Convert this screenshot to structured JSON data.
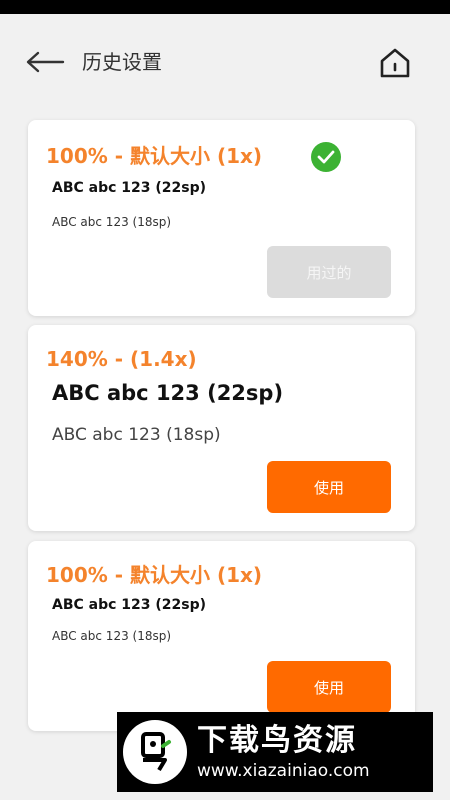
{
  "header": {
    "title": "历史设置",
    "back_icon": "arrow-left-icon",
    "home_icon": "home-icon"
  },
  "options": [
    {
      "title": "100% - 默认大小 (1x)",
      "sample_22": "ABC abc 123 (22sp)",
      "sample_18": "ABC abc 123 (18sp)",
      "button_label": "用过的",
      "selected": true,
      "status_icon": "check-circle-icon"
    },
    {
      "title": "140% - (1.4x)",
      "sample_22": "ABC abc 123 (22sp)",
      "sample_18": "ABC abc 123 (18sp)",
      "button_label": "使用",
      "selected": false
    },
    {
      "title": "100% - 默认大小 (1x)",
      "sample_22": "ABC abc 123 (22sp)",
      "sample_18": "ABC abc 123 (18sp)",
      "button_label": "使用",
      "selected": false
    }
  ],
  "watermark": {
    "title": "下载鸟资源",
    "url": "www.xiazainiao.com"
  },
  "colors": {
    "accent": "#f4832c",
    "button_active": "#ff6a00",
    "button_disabled": "#dcdcdc",
    "check": "#3cb233",
    "background": "#f1f1f1"
  }
}
